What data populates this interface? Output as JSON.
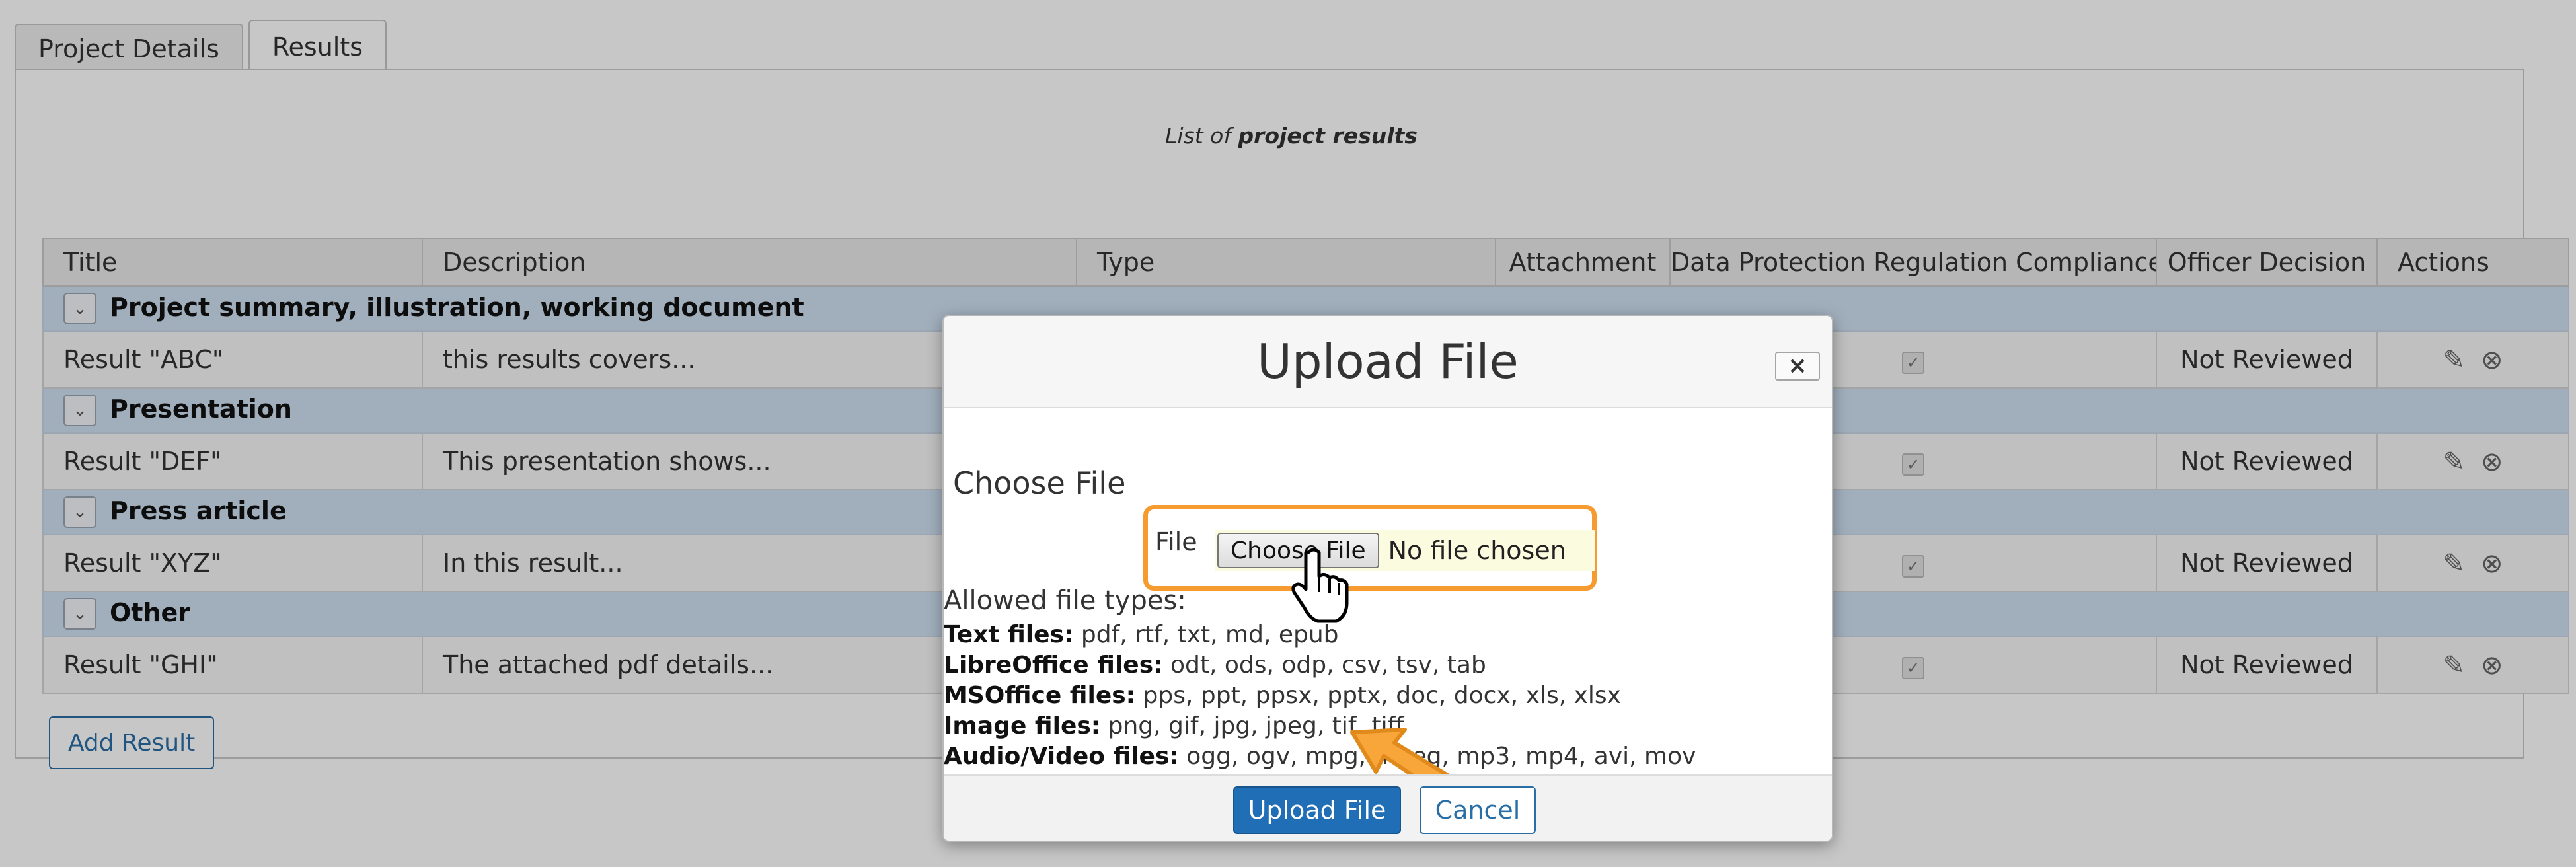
{
  "tabs": [
    "Project Details",
    "Results"
  ],
  "caption": {
    "prefix": "List of",
    "emphasis": "project results"
  },
  "table": {
    "headers": [
      "Title",
      "Description",
      "Type",
      "Attachment",
      "Data Protection Regulation Compliance",
      "Officer Decision",
      "Actions"
    ],
    "groups": [
      {
        "name": "Project summary, illustration, working document",
        "row": {
          "title": "Result \"ABC\"",
          "description": "this results covers...",
          "decision": "Not Reviewed"
        }
      },
      {
        "name": "Presentation",
        "row": {
          "title": "Result \"DEF\"",
          "description": "This presentation shows...",
          "decision": "Not Reviewed"
        }
      },
      {
        "name": "Press article",
        "row": {
          "title": "Result \"XYZ\"",
          "description": "In this result...",
          "decision": "Not Reviewed"
        }
      },
      {
        "name": "Other",
        "row": {
          "title": "Result \"GHI\"",
          "description": "The attached pdf details...",
          "decision": "Not Reviewed"
        }
      }
    ]
  },
  "add_result_label": "Add Result",
  "modal": {
    "title": "Upload File",
    "close_label": "×",
    "section_title": "Choose File",
    "file_label": "File",
    "choose_button": "Choose File",
    "no_file_text": "No file chosen",
    "allowed_heading": "Allowed file types:",
    "file_types": [
      {
        "label": "Text files:",
        "exts": "pdf, rtf, txt, md, epub"
      },
      {
        "label": "LibreOffice files:",
        "exts": "odt, ods, odp, csv, tsv, tab"
      },
      {
        "label": "MSOffice files:",
        "exts": "pps, ppt, ppsx, pptx, doc, docx, xls, xlsx"
      },
      {
        "label": "Image files:",
        "exts": "png, gif, jpg, jpeg, tif, tiff"
      },
      {
        "label": "Audio/Video files:",
        "exts": "ogg, ogv, mpg, mpeg, mp3, mp4, avi, mov"
      }
    ],
    "upload_button": "Upload File",
    "cancel_button": "Cancel"
  },
  "colors": {
    "highlight": "#f59b2f",
    "primary": "#1f6eb6",
    "group_bg": "#cfe0f3"
  },
  "icons": [
    "chevron-down-icon",
    "download-icon",
    "delete-file-icon",
    "pencil-icon",
    "remove-circle-icon",
    "hand-cursor-icon",
    "pointer-arrow-icon"
  ]
}
